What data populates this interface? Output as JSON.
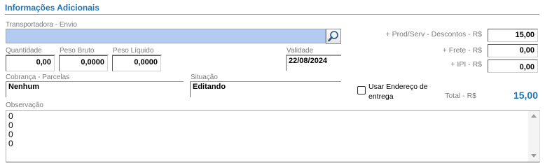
{
  "section_title": "Informações Adicionais",
  "transportadora": {
    "label": "Transportadora - Envio",
    "value": ""
  },
  "quantidade": {
    "label": "Quantidade",
    "value": "0,00"
  },
  "peso_bruto": {
    "label": "Peso Bruto",
    "value": "0,0000"
  },
  "peso_liquido": {
    "label": "Peso Líquido",
    "value": "0,0000"
  },
  "validade": {
    "label": "Validade",
    "value": "22/08/2024"
  },
  "cobranca": {
    "label": "Cobrança - Parcelas",
    "value": "Nenhum"
  },
  "situacao": {
    "label": "Situação",
    "value": "Editando"
  },
  "prod_serv": {
    "label": "+ Prod/Serv - Descontos - R$",
    "value": "15,00"
  },
  "frete": {
    "label": "+ Frete - R$",
    "value": "0,00"
  },
  "ipi": {
    "label": "+ IPI - R$",
    "value": "0,00"
  },
  "usar_endereco": {
    "label_line1": "Usar Endereço de",
    "label_line2": "entrega",
    "checked": false
  },
  "total": {
    "label": "Total - R$",
    "value": "15,00"
  },
  "observacao": {
    "label": "Observação",
    "lines": [
      "0",
      "0",
      "0",
      "0"
    ]
  },
  "colors": {
    "accent": "#1f74b5",
    "field_highlight": "#b3cbf1"
  },
  "icons": {
    "search": "magnifier-icon",
    "scroll_up": "chevron-up-icon",
    "scroll_down": "chevron-down-icon"
  }
}
